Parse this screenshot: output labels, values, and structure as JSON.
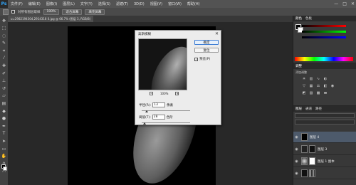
{
  "app": {
    "logo": "Ps"
  },
  "menu": [
    "文件(F)",
    "编辑(E)",
    "图像(I)",
    "图层(L)",
    "文字(Y)",
    "选择(S)",
    "滤镜(T)",
    "3D(D)",
    "视图(V)",
    "窗口(W)",
    "帮助(H)"
  ],
  "window_controls": {
    "minimize": "—",
    "restore": "□",
    "close": "✕"
  },
  "options_bar": {
    "sample_all_layers": "对所有图层取样",
    "zoom_value": "100%",
    "fit_screen": "适合屏幕",
    "fill_screen": "填充屏幕"
  },
  "document": {
    "tab_title": "u=2982194304,2914318 0.jpg @ 66.7% (图层 3, RGB/8)"
  },
  "dialog": {
    "title": "高斯模糊",
    "ok_label": "确定",
    "cancel_label": "复位",
    "preview_label": "预览(P)",
    "preview_checked": true,
    "zoom_label": "100%",
    "radius_label": "半径(R):",
    "radius_value": "13",
    "radius_unit": "像素",
    "threshold_label": "阈值(T):",
    "threshold_value": "28",
    "threshold_unit": "色阶"
  },
  "panels": {
    "color_tabs": [
      "颜色",
      "色板"
    ],
    "adjust_tab": "调整",
    "adjust_label": "添加调整",
    "layers_tabs": [
      "图层",
      "通道",
      "路径"
    ],
    "layers": [
      {
        "name": "图层 4",
        "visible": true,
        "selected": true
      },
      {
        "name": "图层 3",
        "visible": true,
        "selected": false
      },
      {
        "name": "图层 1 副本",
        "visible": true,
        "selected": false
      },
      {
        "name": "",
        "visible": true,
        "selected": false
      }
    ]
  },
  "colors": {
    "accent": "#31a8ff",
    "selection": "#4d5a6b"
  }
}
